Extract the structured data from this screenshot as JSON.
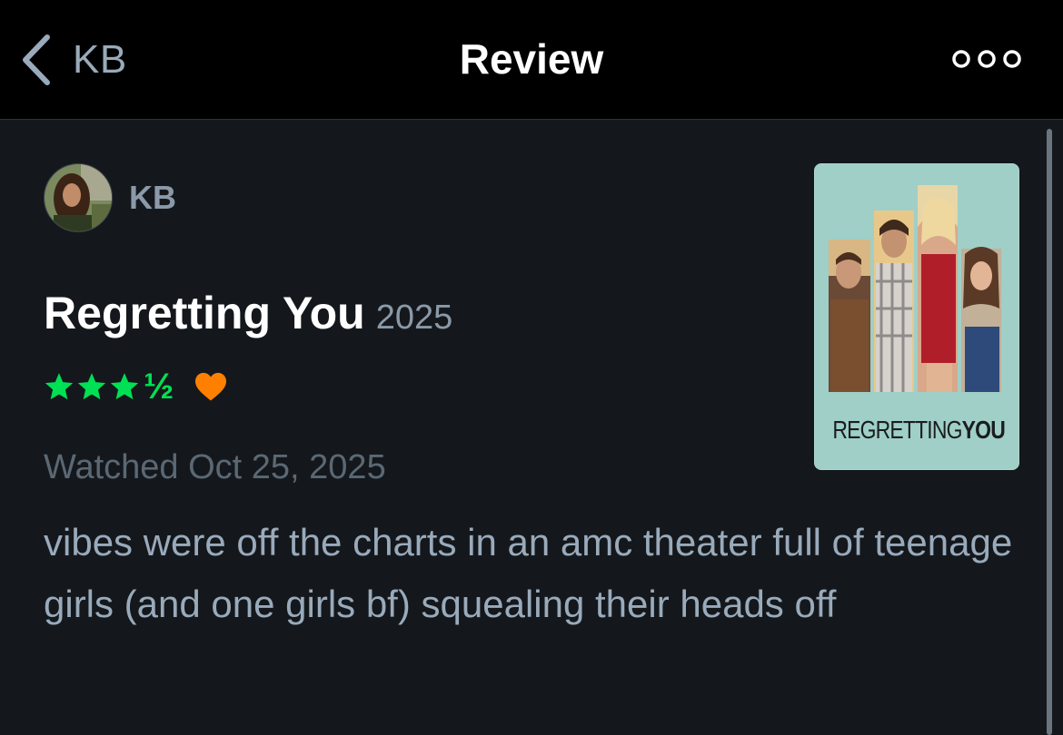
{
  "navbar": {
    "back_label": "KB",
    "title": "Review",
    "back_icon": "chevron-left-icon",
    "more_icon": "more-dots-icon"
  },
  "review": {
    "author": "KB",
    "film_title": "Regretting You",
    "year": "2025",
    "rating_stars": 3.5,
    "rating_half_glyph": "½",
    "liked": true,
    "watched": "Watched Oct 25, 2025",
    "text": "vibes were off the charts in an amc theater full of teenage girls (and one girls bf) squealing their heads off"
  },
  "poster": {
    "title_part1": "REGRETTING",
    "title_part2": "YOU"
  },
  "colors": {
    "background": "#14181c",
    "navbar": "#000000",
    "star": "#00e054",
    "heart": "#ff8000",
    "muted": "#99aabb",
    "poster_bg": "#9fcfc6"
  }
}
